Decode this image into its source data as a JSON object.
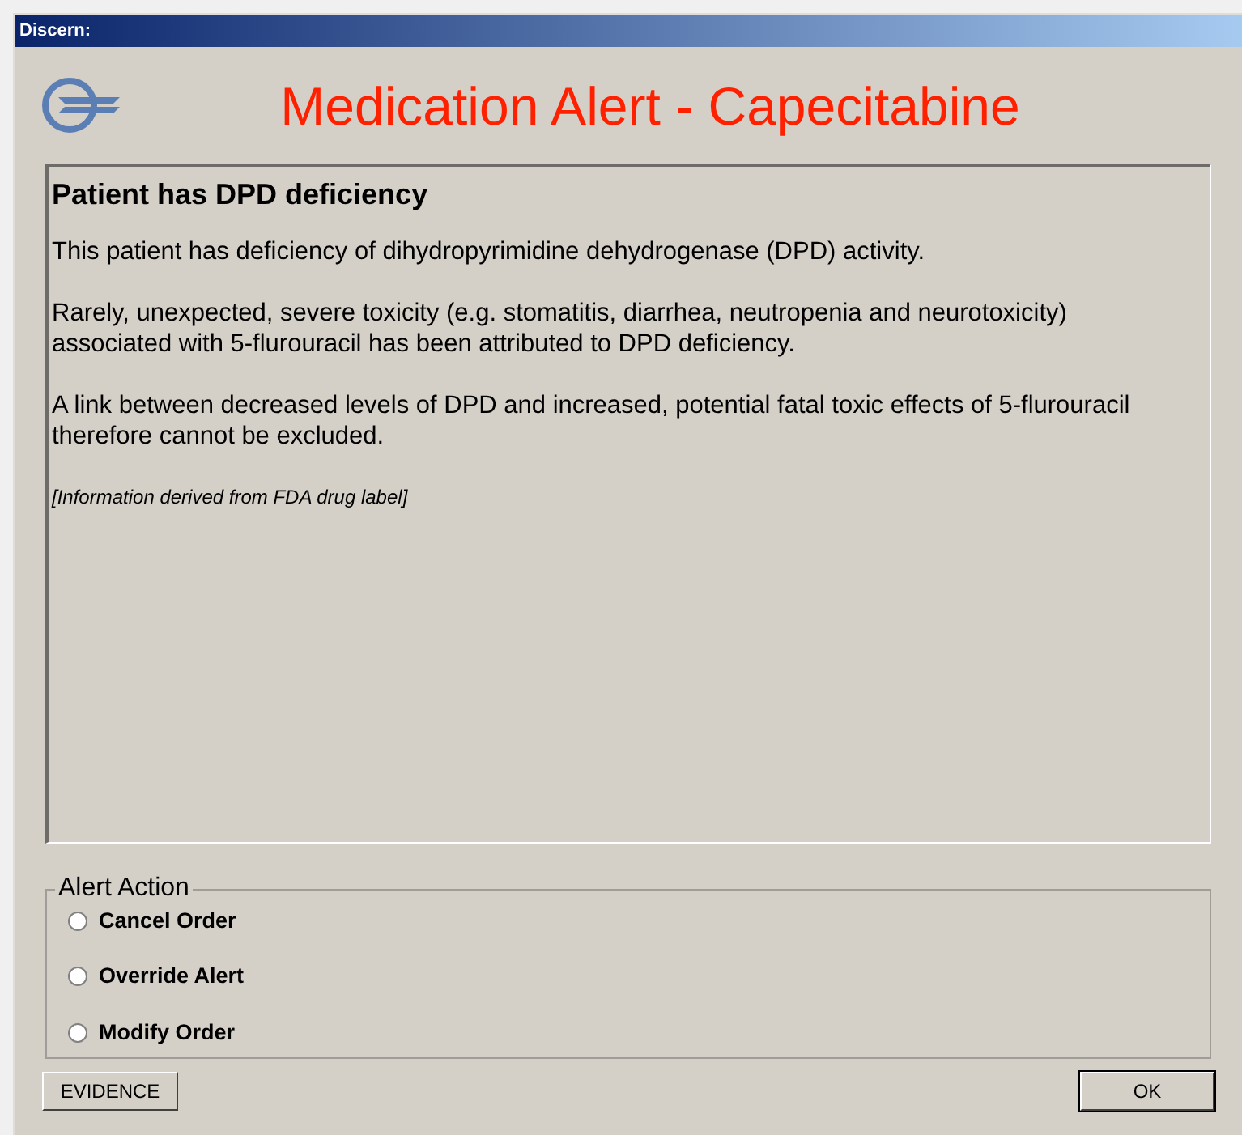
{
  "window": {
    "title": "Discern:"
  },
  "alert_title": "Medication Alert - Capecitabine",
  "message": {
    "heading": "Patient has DPD deficiency",
    "paragraphs": [
      "This patient has deficiency of dihydropyrimidine dehydrogenase (DPD) activity.",
      "Rarely, unexpected, severe toxicity (e.g. stomatitis, diarrhea, neutropenia and neurotoxicity) associated with 5-flurouracil has been attributed to DPD deficiency.",
      "A link between decreased levels of DPD and increased, potential fatal toxic effects of 5-flurouracil therefore cannot be excluded."
    ],
    "source": "[Information derived from FDA drug label]"
  },
  "alert_action": {
    "label": "Alert Action",
    "options": [
      {
        "label": "Cancel Order",
        "selected": false
      },
      {
        "label": "Override Alert",
        "selected": false
      },
      {
        "label": "Modify Order",
        "selected": false
      }
    ]
  },
  "buttons": [
    "EVIDENCE",
    "OK"
  ]
}
